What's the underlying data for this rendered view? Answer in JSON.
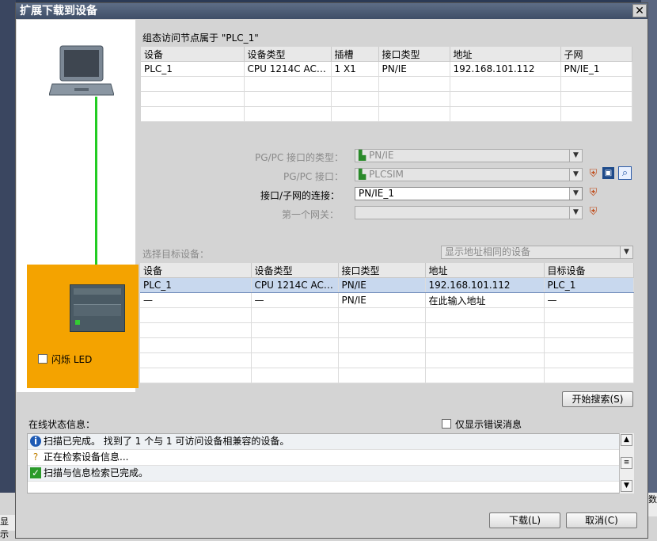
{
  "window": {
    "title": "扩展下载到设备",
    "close_glyph": "✕"
  },
  "background_text": {
    "bottom_left": "显示",
    "bottom_right": "参数"
  },
  "access_node": {
    "caption": "组态访问节点属于 \"PLC_1\"",
    "columns": [
      "设备",
      "设备类型",
      "插槽",
      "接口类型",
      "地址",
      "子网"
    ],
    "rows": [
      [
        "PLC_1",
        "CPU 1214C AC/D...",
        "1 X1",
        "PN/IE",
        "192.168.101.112",
        "PN/IE_1"
      ]
    ]
  },
  "interface": {
    "type_label": "PG/PC 接口的类型：",
    "type_value": "PN/IE",
    "interface_label": "PG/PC 接口：",
    "interface_value": "PLCSIM",
    "subnet_label": "接口/子网的连接：",
    "subnet_value": "PN/IE_1",
    "gateway_label": "第一个网关：",
    "gateway_value": ""
  },
  "target": {
    "caption": "选择目标设备：",
    "filter_value": "显示地址相同的设备",
    "columns": [
      "设备",
      "设备类型",
      "接口类型",
      "地址",
      "目标设备"
    ],
    "rows": [
      [
        "PLC_1",
        "CPU 1214C AC/D...",
        "PN/IE",
        "192.168.101.112",
        "PLC_1"
      ],
      [
        "—",
        "—",
        "PN/IE",
        "在此输入地址",
        "—"
      ]
    ]
  },
  "flash_led_label": "闪烁 LED",
  "start_search_label": "开始搜索(S)",
  "online_status": {
    "caption": "在线状态信息：",
    "only_errors_label": "仅显示错误消息",
    "messages": [
      {
        "icon": "info-icon",
        "text": "扫描已完成。 找到了 1 个与 1 可访问设备相兼容的设备。"
      },
      {
        "icon": "search-device-icon",
        "text": "正在检索设备信息..."
      },
      {
        "icon": "success-check-icon",
        "text": "扫描与信息检索已完成。"
      }
    ]
  },
  "buttons": {
    "download": "下载(L)",
    "cancel": "取消(C)"
  },
  "colors": {
    "accent": "#f4a300",
    "link_line": "#22cc22",
    "selected_row": "#c8d8ee"
  }
}
